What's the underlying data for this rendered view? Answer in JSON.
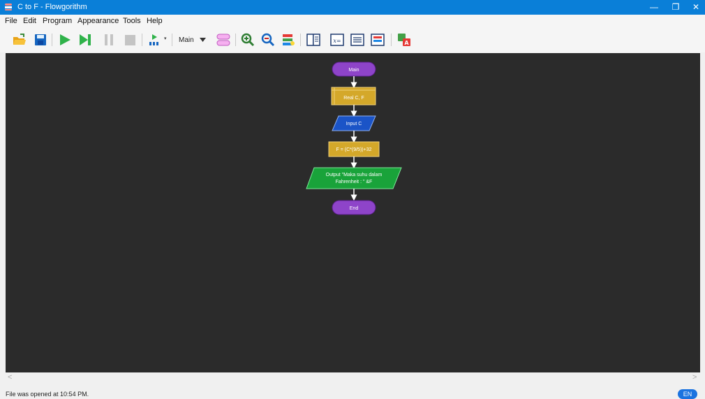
{
  "window": {
    "title": "C to F - Flowgorithm"
  },
  "window_controls": {
    "minimize": "—",
    "restore": "❐",
    "close": "✕"
  },
  "menu": [
    "File",
    "Edit",
    "Program",
    "Appearance",
    "Tools",
    "Help"
  ],
  "toolbar": {
    "function_selector": "Main"
  },
  "flowchart": {
    "start": "Main",
    "declare": "Real C, F",
    "input": "Input C",
    "assign": "F = (C*(9/5))+32",
    "output_line1": "Output \"Maka suhu dalam",
    "output_line2": "Fahrenheit : \" &F",
    "end": "End"
  },
  "scrollbar": {
    "left_arrow": "<",
    "right_arrow": ">"
  },
  "status": {
    "message": "File was opened at 10:54 PM.",
    "language": "EN"
  }
}
